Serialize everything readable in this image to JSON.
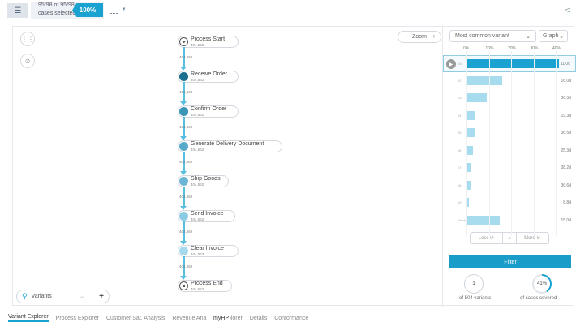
{
  "topbar": {
    "menu_icon": "hamburger-icon",
    "cases_line1": "95/98 of 95/98",
    "cases_line2": "cases selected",
    "percent": "100%",
    "share_icon": "share-icon"
  },
  "canvas": {
    "zoom_label": "Zoom",
    "zoom_minus": "−",
    "zoom_plus": "+",
    "variants_label": "Variants",
    "variants_minus": "−",
    "variants_plus": "+"
  },
  "process": {
    "nodes": [
      {
        "name": "Process Start",
        "count": "404,562",
        "type": "start"
      },
      {
        "name": "Receive Order",
        "count": "404,562",
        "color": "#1b6f8f"
      },
      {
        "name": "Confirm Order",
        "count": "404,562",
        "color": "#3a95b7"
      },
      {
        "name": "Generate Delivery Document",
        "count": "404,562",
        "color": "#58aacb"
      },
      {
        "name": "Ship Goods",
        "count": "404,562",
        "color": "#6cb6d5"
      },
      {
        "name": "Send Invoice",
        "count": "404,562",
        "color": "#8ccbe4"
      },
      {
        "name": "Clear Invoice",
        "count": "404,562",
        "color": "#a7d9ee"
      },
      {
        "name": "Process End",
        "count": "404,562",
        "type": "end"
      }
    ],
    "edges": [
      "404,562",
      "404,562",
      "404,562",
      "404,562",
      "404,562",
      "404,562",
      "404,562"
    ]
  },
  "right_panel": {
    "variant_dropdown": "Most common variant",
    "graph_dropdown": "Graph",
    "pct_ticks": [
      "0%",
      "10%",
      "20%",
      "30%",
      "40%"
    ],
    "variants": [
      {
        "label": "#1",
        "percent": 41,
        "duration": "11.0d"
      },
      {
        "label": "#2",
        "percent": 16,
        "duration": "16.0d"
      },
      {
        "label": "#3",
        "percent": 9,
        "duration": "36.3d"
      },
      {
        "label": "#4",
        "percent": 4,
        "duration": "19.3d"
      },
      {
        "label": "#5",
        "percent": 4,
        "duration": "36.5d"
      },
      {
        "label": "#6",
        "percent": 3,
        "duration": "25.3d"
      },
      {
        "label": "#7",
        "percent": 2,
        "duration": "38.2d"
      },
      {
        "label": "#8",
        "percent": 2,
        "duration": "36.6d"
      },
      {
        "label": "#9",
        "percent": 1,
        "duration": "8.8d"
      },
      {
        "label": "others",
        "percent": 15,
        "duration": "15.0d"
      }
    ],
    "less_label": "Less",
    "more_label": "More",
    "filter_label": "Filter",
    "variants_count": "1",
    "variants_caption": "of 504 variants",
    "cases_percent": "41%",
    "cases_percent_value": 41,
    "cases_caption": "of cases covered"
  },
  "tabs": [
    {
      "label": "Variant Explorer",
      "active": true
    },
    {
      "label": "Process Explorer"
    },
    {
      "label": "Customer Sat. Analysis"
    },
    {
      "label": "Revenue Ana"
    },
    {
      "label": "se Explorer"
    },
    {
      "label": "Details"
    },
    {
      "label": "Conformance"
    }
  ],
  "overlay_text": "myHP"
}
